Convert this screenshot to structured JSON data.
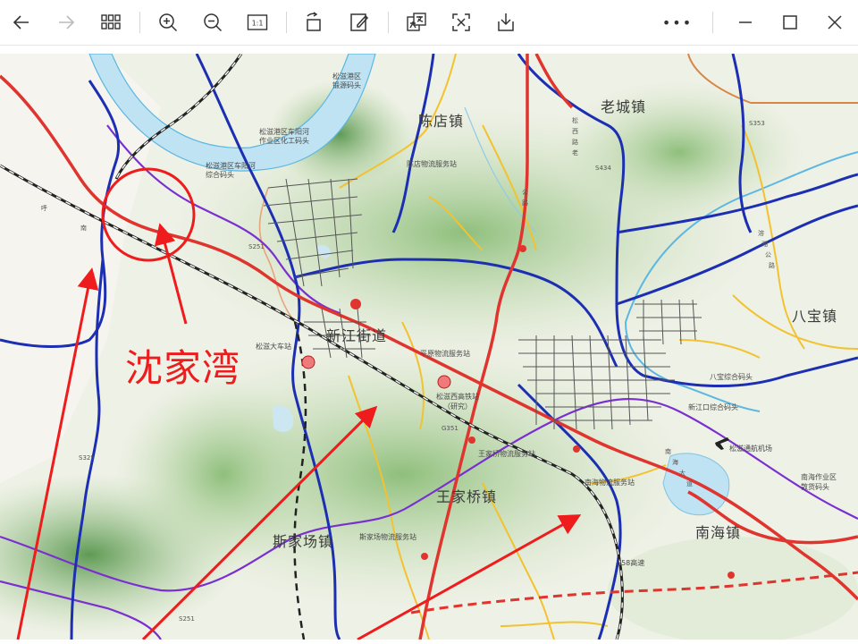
{
  "toolbar": {
    "icons": [
      "back-arrow-icon",
      "forward-arrow-icon",
      "grid-view-icon",
      "zoom-in-icon",
      "zoom-out-icon",
      "actual-size-icon",
      "rotate-icon",
      "edit-icon",
      "translate-icon",
      "crop-icon",
      "download-icon",
      "more-icon",
      "minimize-icon",
      "maximize-icon",
      "close-icon"
    ],
    "actual_size_label": "1:1",
    "more_label": "•••"
  },
  "map": {
    "towns": [
      "陈店镇",
      "老城镇",
      "八宝镇",
      "南海镇",
      "王家桥镇",
      "斯家场镇"
    ],
    "street_label": "新江街道",
    "annotation": "沈家湾",
    "small_labels": {
      "port_a": "松滋港区",
      "port_a2": "锻源码头",
      "port_b": "松滋港区车阳河",
      "port_b2": "作业区化工码头",
      "port_c": "松滋港区车阳河",
      "port_c2": "综合码头",
      "logistics_a": "陈店物流服务站",
      "station": "松滋大车站",
      "logistics_b": "平原物流服务站",
      "hsr": "松滋西高铁站",
      "hsr2": "（研究）",
      "logistics_c": "王家桥物流服务站",
      "logistics_d": "斯家场物流服务站",
      "logistics_e": "南海物流服务站",
      "port_d": "八宝综合码头",
      "port_e": "新江口综合码头",
      "airport": "松滋通航机场",
      "port_f": "南海作业区",
      "port_f2": "散货码头",
      "highway": "S58高速"
    },
    "road_codes": {
      "a": "S434",
      "b": "S251",
      "c": "G351",
      "d": "S325",
      "e": "S353",
      "f": "S251"
    },
    "vertical_road_chars": [
      "松",
      "西",
      "路",
      "老",
      "公",
      "路",
      "溶",
      "湘",
      "公",
      "路",
      "南",
      "海",
      "大",
      "道",
      "呼",
      "南"
    ],
    "colors": {
      "annotation": "#ee1c1c",
      "expressway": "#e0342e",
      "national_road": "#1c2fb3",
      "provincial_road": "#7a2fd0",
      "rail": "#222222",
      "county_road": "#f2c230",
      "river": "#5cb7e2",
      "green_high": "#7fae6e",
      "green_low": "#cfe2bf",
      "urban_grid": "#555555"
    }
  }
}
